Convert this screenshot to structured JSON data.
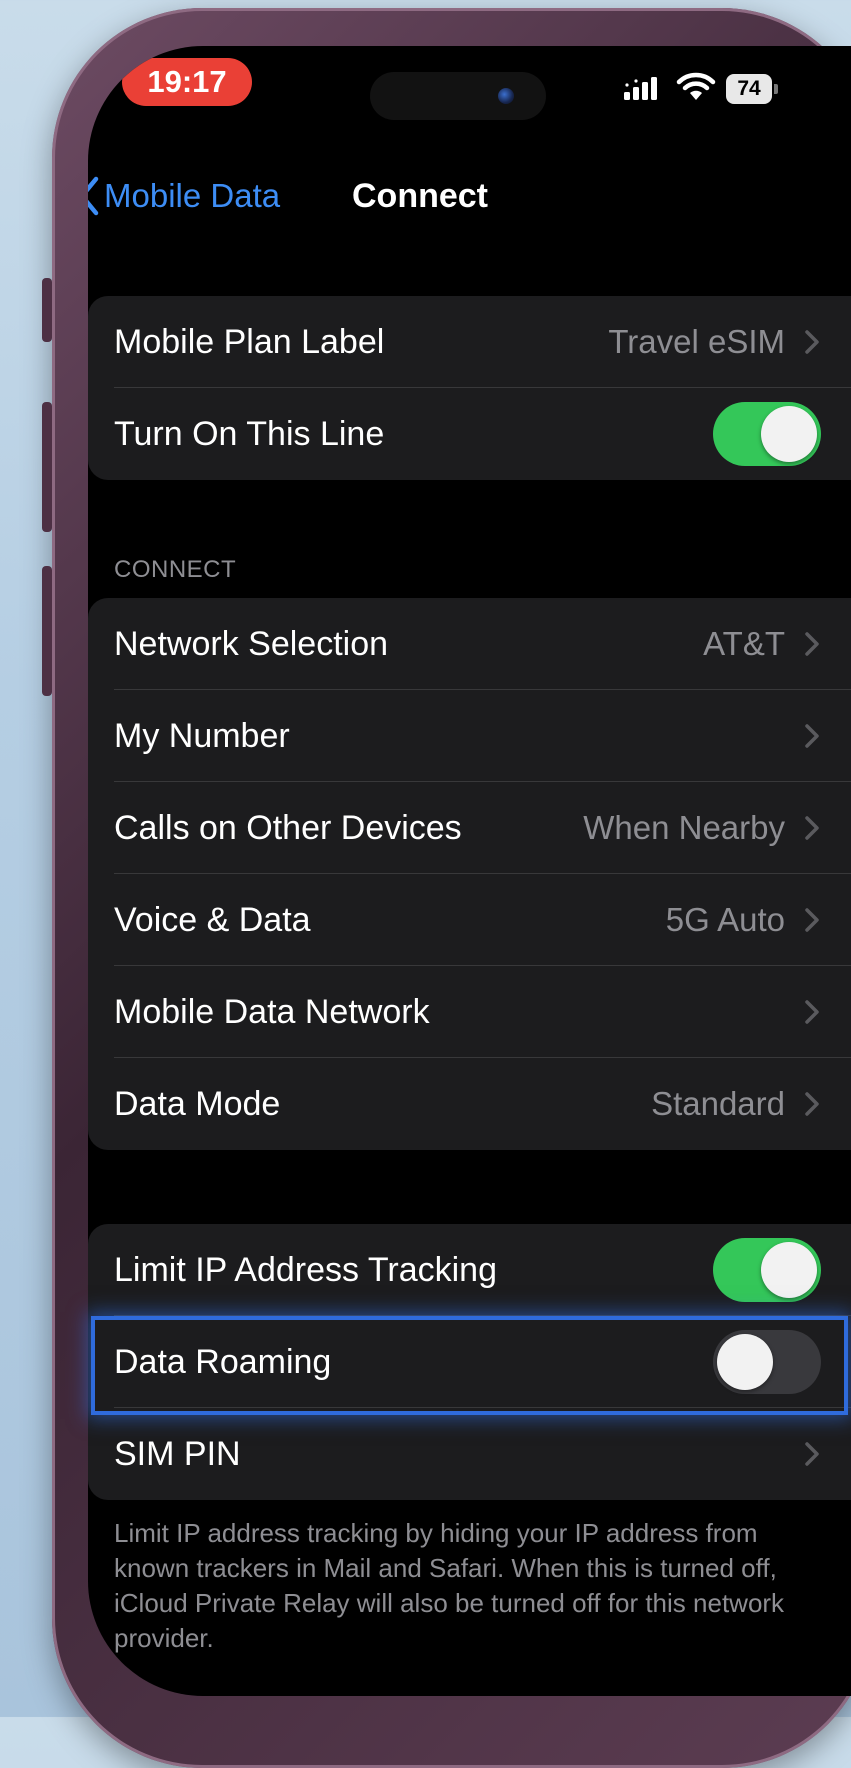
{
  "status_bar": {
    "time": "19:17",
    "battery": "74",
    "icons": [
      "cellular-signal-icon",
      "wifi-icon",
      "battery-icon"
    ]
  },
  "nav": {
    "back_label": "Mobile Data",
    "title": "Connect"
  },
  "group1": {
    "rows": [
      {
        "label": "Mobile Plan Label",
        "value": "Travel eSIM"
      },
      {
        "label": "Turn On This Line",
        "toggle": true
      }
    ]
  },
  "connect_section": {
    "header": "CONNECT",
    "rows": [
      {
        "label": "Network Selection",
        "value": "AT&T"
      },
      {
        "label": "My Number",
        "value": ""
      },
      {
        "label": "Calls on Other Devices",
        "value": "When Nearby"
      },
      {
        "label": "Voice & Data",
        "value": "5G Auto"
      },
      {
        "label": "Mobile Data Network",
        "value": ""
      },
      {
        "label": "Data Mode",
        "value": "Standard"
      }
    ]
  },
  "group3": {
    "rows": [
      {
        "label": "Limit IP Address Tracking",
        "toggle": true
      },
      {
        "label": "Data Roaming",
        "toggle": false
      },
      {
        "label": "SIM PIN",
        "value": ""
      }
    ]
  },
  "footer_note": "Limit IP address tracking by hiding your IP address from known trackers in Mail and Safari. When this is turned off, iCloud Private Relay will also be turned off for this network provider.",
  "colors": {
    "accent": "#3d8df5",
    "toggle_on": "#34c759",
    "toggle_off": "#39393d",
    "highlight": "#2f6bdc",
    "time_pill": "#ea4036"
  }
}
